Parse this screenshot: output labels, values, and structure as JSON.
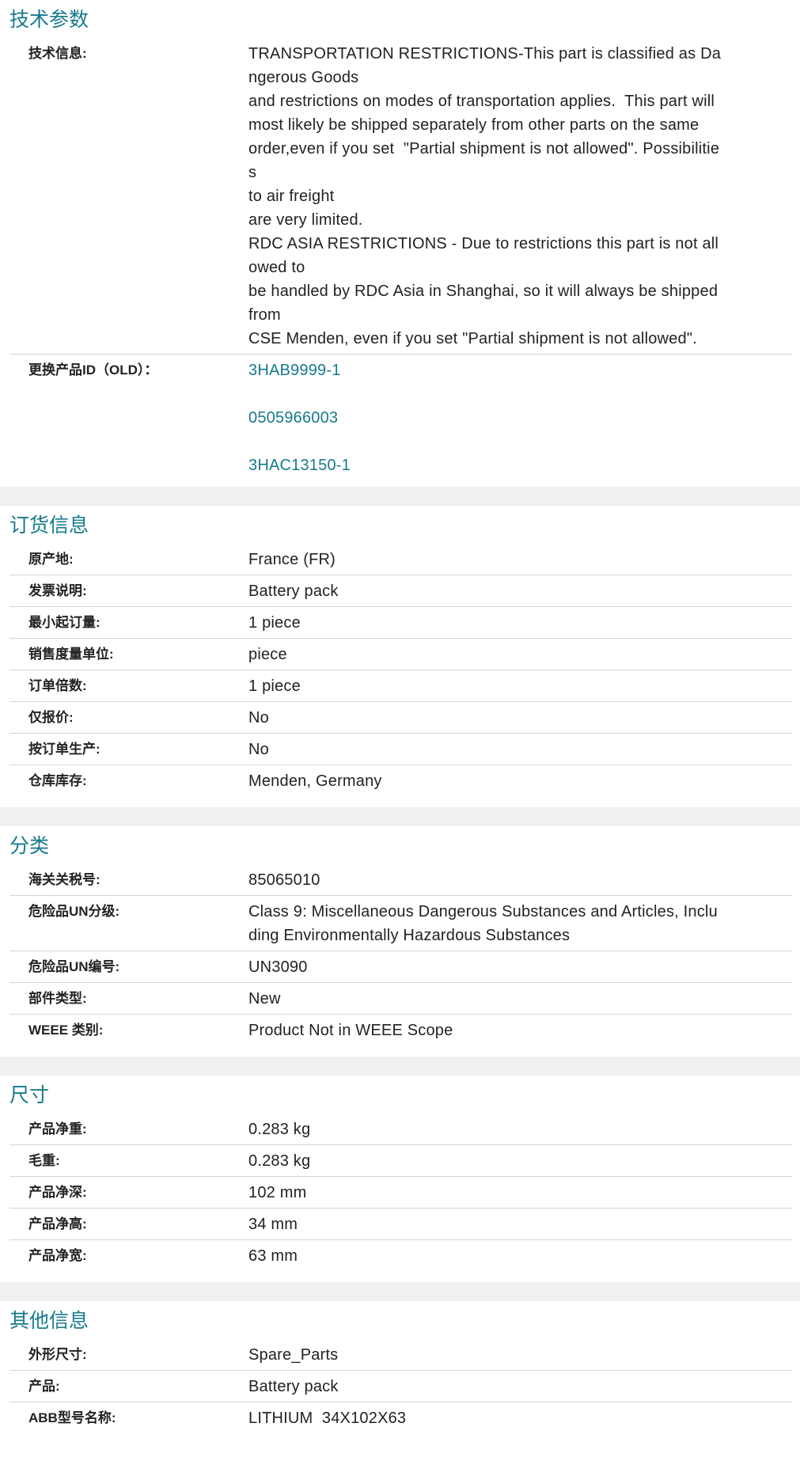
{
  "tech": {
    "title": "技术参数",
    "info_label": "技术信息:",
    "info_lines": [
      "TRANSPORTATION RESTRICTIONS-This part is classified as Da",
      "ngerous Goods",
      "and restrictions on modes of transportation applies.  This part will",
      "most likely be shipped separately from other parts on the same",
      "order,even if you set  \"Partial shipment is not allowed\". Possibilitie",
      "s",
      "to air freight",
      "are very limited.",
      "RDC ASIA RESTRICTIONS - Due to restrictions this part is not all",
      "owed to",
      "be handled by RDC Asia in Shanghai, so it will always be shipped",
      "from",
      "CSE Menden, even if you set \"Partial shipment is not allowed\"."
    ],
    "replaced_label": "更换产品ID（OLD）：",
    "replaced_ids": [
      "3HAB9999-1",
      "0505966003",
      "3HAC13150-1"
    ]
  },
  "ordering": {
    "title": "订货信息",
    "rows": [
      {
        "label": "原产地:",
        "value": "France (FR)"
      },
      {
        "label": "发票说明:",
        "value": "Battery pack"
      },
      {
        "label": "最小起订量:",
        "value": "1 piece"
      },
      {
        "label": "销售度量单位:",
        "value": "piece"
      },
      {
        "label": "订单倍数:",
        "value": "1 piece"
      },
      {
        "label": "仅报价:",
        "value": "No"
      },
      {
        "label": "按订单生产:",
        "value": "No"
      },
      {
        "label": "仓库库存:",
        "value": "Menden, Germany"
      }
    ]
  },
  "classification": {
    "title": "分类",
    "rows": [
      {
        "label": "海关关税号:",
        "value": "85065010"
      },
      {
        "label": "危险品UN分级:",
        "value": "Class 9: Miscellaneous Dangerous Substances and Articles, Inclu",
        "value2": "ding Environmentally Hazardous Substances"
      },
      {
        "label": "危险品UN编号:",
        "value": "UN3090"
      },
      {
        "label": "部件类型:",
        "value": "New"
      },
      {
        "label": "WEEE 类别:",
        "value": "Product Not in WEEE Scope"
      }
    ]
  },
  "dimensions": {
    "title": "尺寸",
    "rows": [
      {
        "label": "产品净重:",
        "value": "0.283 kg"
      },
      {
        "label": "毛重:",
        "value": "0.283 kg"
      },
      {
        "label": "产品净深:",
        "value": "102 mm"
      },
      {
        "label": "产品净高:",
        "value": "34 mm"
      },
      {
        "label": "产品净宽:",
        "value": "63 mm"
      }
    ]
  },
  "other": {
    "title": "其他信息",
    "rows": [
      {
        "label": "外形尺寸:",
        "value": "Spare_Parts"
      },
      {
        "label": "产品:",
        "value": "Battery pack"
      },
      {
        "label": "ABB型号名称:",
        "value": "LITHIUM  34X102X63"
      }
    ]
  },
  "colors": {
    "accent": "#167a8c",
    "divider": "#d6d6d6",
    "gap": "#f0f0f0"
  }
}
